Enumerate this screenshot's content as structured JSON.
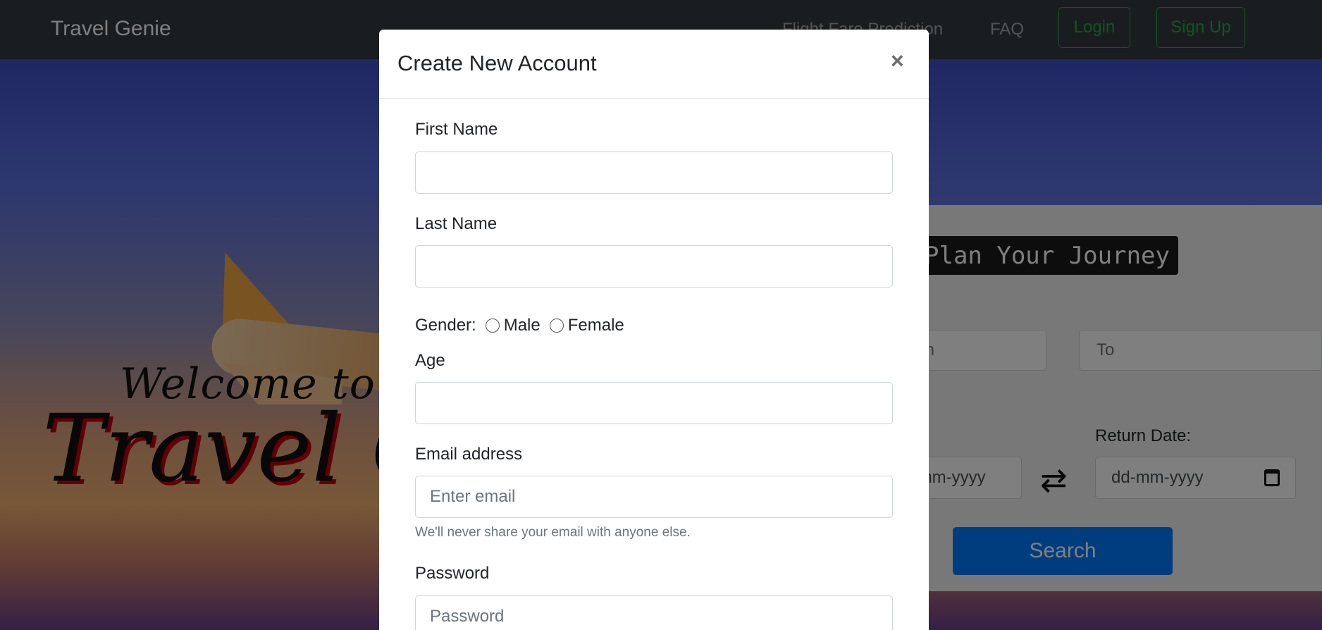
{
  "navbar": {
    "brand": "Travel Genie",
    "links": [
      "Flight Fare Prediction",
      "FAQ"
    ],
    "login_label": "Login",
    "signup_label": "Sign Up"
  },
  "hero": {
    "welcome_small": "Welcome to",
    "welcome_big": "Travel Genie"
  },
  "search": {
    "title": "Plan Your Journey",
    "from_placeholder": "From",
    "to_placeholder": "To",
    "return_label": "Return Date:",
    "departure_date_placeholder": "dd-mm-yyyy",
    "return_date_placeholder": "dd-mm-yyyy",
    "search_label": "Search"
  },
  "modal": {
    "title": "Create New Account",
    "close_symbol": "×",
    "first_name_label": "First Name",
    "last_name_label": "Last Name",
    "gender_label": "Gender:",
    "gender_options": [
      "Male",
      "Female"
    ],
    "age_label": "Age",
    "email_label": "Email address",
    "email_placeholder": "Enter email",
    "email_help": "We'll never share your email with anyone else.",
    "password_label": "Password",
    "password_placeholder": "Password"
  },
  "colors": {
    "navbar": "#343a40",
    "accent_green": "#28a745",
    "primary_blue": "#007bff"
  },
  "icons": [
    "close-icon",
    "calendar-icon",
    "swap-icon",
    "plane-image"
  ]
}
